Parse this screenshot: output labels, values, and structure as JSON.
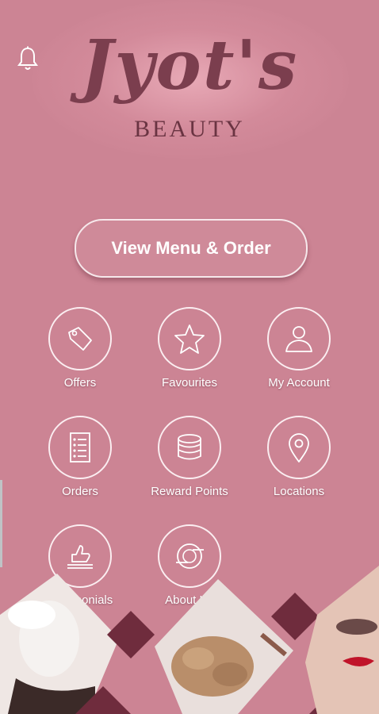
{
  "header": {
    "brand_name": "Jyot's",
    "brand_subtitle": "BEAUTY",
    "bell_icon": "bell-icon"
  },
  "cta": {
    "label": "View Menu & Order"
  },
  "menu": [
    {
      "label": "Offers",
      "icon": "tag-icon"
    },
    {
      "label": "Favourites",
      "icon": "star-icon"
    },
    {
      "label": "My Account",
      "icon": "user-icon"
    },
    {
      "label": "Orders",
      "icon": "list-icon"
    },
    {
      "label": "Reward Points",
      "icon": "coins-icon"
    },
    {
      "label": "Locations",
      "icon": "map-pin-icon"
    },
    {
      "label": "Testimonials",
      "icon": "thumbs-up-icon"
    },
    {
      "label": "About Us",
      "icon": "plate-cutlery-icon"
    }
  ],
  "colors": {
    "background": "#cc8494",
    "logo": "#7b3e4e",
    "accent_dark": "#6f2c3d",
    "text": "#ffffff"
  }
}
